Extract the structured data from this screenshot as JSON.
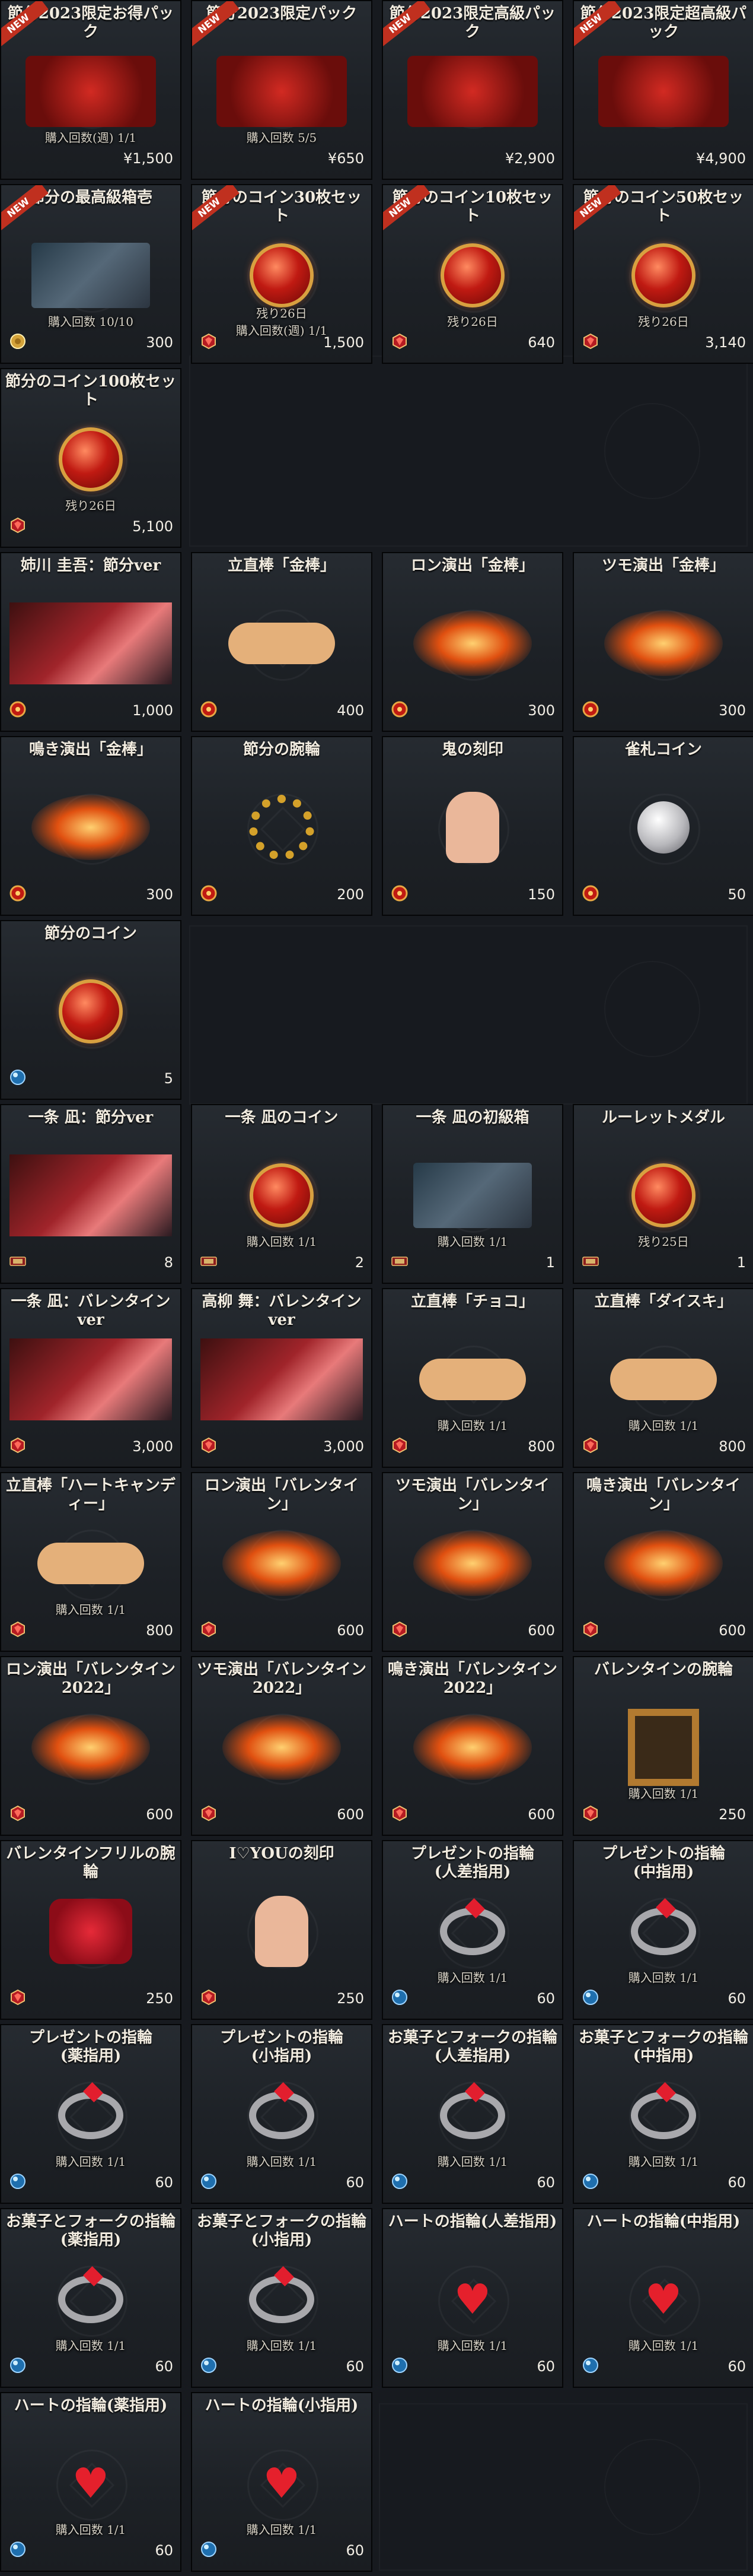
{
  "shop": {
    "sections": [
      {
        "name": "setsubun-2023-packs",
        "items": [
          {
            "title": "節分2023限定お得パック",
            "icon": "pack-icon",
            "badge": "NEW",
            "limit": "購入回数(週) 1/1",
            "currency": "yen",
            "price": "¥1,500"
          },
          {
            "title": "節分2023限定パック",
            "icon": "pack-icon",
            "badge": "NEW",
            "limit": "購入回数 5/5",
            "currency": "yen",
            "price": "¥650"
          },
          {
            "title": "節分2023限定高級パック",
            "icon": "pack-icon",
            "badge": "NEW",
            "limit": "",
            "currency": "yen",
            "price": "¥2,900"
          },
          {
            "title": "節分2023限定超高級パック",
            "icon": "pack-icon",
            "badge": "NEW",
            "limit": "",
            "currency": "yen",
            "price": "¥4,900"
          },
          {
            "title": "節分の最高級箱壱",
            "icon": "chest-icon",
            "badge": "NEW",
            "limit": "購入回数 10/10",
            "currency": "coin-gold",
            "price": "300"
          },
          {
            "title": "節分のコイン30枚セット",
            "icon": "setsubun-coin-icon",
            "badge": "NEW",
            "limit": "残り26日\n購入回数(週) 1/1",
            "currency": "jewel",
            "price": "1,500"
          },
          {
            "title": "節分のコイン10枚セット",
            "icon": "setsubun-coin-icon",
            "badge": "NEW",
            "limit": "残り26日",
            "currency": "jewel",
            "price": "640"
          },
          {
            "title": "節分のコイン50枚セット",
            "icon": "setsubun-coin-icon",
            "badge": "NEW",
            "limit": "残り26日",
            "currency": "jewel",
            "price": "3,140"
          },
          {
            "title": "節分のコイン100枚セット",
            "icon": "setsubun-coin-icon",
            "badge": "",
            "limit": "残り26日",
            "currency": "jewel",
            "price": "5,100"
          }
        ]
      },
      {
        "name": "setsubun-coin-exchange",
        "items": [
          {
            "title": "姉川 圭吾：節分ver",
            "icon": "character-art-icon",
            "limit": "",
            "currency": "setsubun-coin",
            "price": "1,000"
          },
          {
            "title": "立直棒「金棒」",
            "icon": "riichi-stick-icon",
            "limit": "",
            "currency": "setsubun-coin",
            "price": "400"
          },
          {
            "title": "ロン演出「金棒」",
            "icon": "ron-effect-icon",
            "limit": "",
            "currency": "setsubun-coin",
            "price": "300"
          },
          {
            "title": "ツモ演出「金棒」",
            "icon": "tsumo-effect-icon",
            "limit": "",
            "currency": "setsubun-coin",
            "price": "300"
          },
          {
            "title": "鳴き演出「金棒」",
            "icon": "call-effect-icon",
            "limit": "",
            "currency": "setsubun-coin",
            "price": "300"
          },
          {
            "title": "節分の腕輪",
            "icon": "bracelet-icon",
            "limit": "",
            "currency": "setsubun-coin",
            "price": "200"
          },
          {
            "title": "鬼の刻印",
            "icon": "hand-mark-icon",
            "limit": "",
            "currency": "setsubun-coin",
            "price": "150"
          },
          {
            "title": "雀札コイン",
            "icon": "silver-coin-icon",
            "limit": "",
            "currency": "setsubun-coin",
            "price": "50"
          },
          {
            "title": "節分のコイン",
            "icon": "setsubun-coin-icon",
            "limit": "",
            "currency": "orb",
            "price": "5"
          }
        ]
      },
      {
        "name": "ichijo-valentine",
        "items": [
          {
            "title": "一条 凪：節分ver",
            "icon": "character-art-icon",
            "limit": "",
            "currency": "ticket",
            "price": "8"
          },
          {
            "title": "一条 凪のコイン",
            "icon": "nagi-coin-icon",
            "limit": "購入回数 1/1",
            "currency": "ticket",
            "price": "2"
          },
          {
            "title": "一条 凪の初級箱",
            "icon": "chest-icon",
            "limit": "購入回数 1/1",
            "currency": "ticket",
            "price": "1"
          },
          {
            "title": "ルーレットメダル",
            "icon": "roulette-medal-icon",
            "limit": "残り25日",
            "currency": "ticket",
            "price": "1"
          },
          {
            "title": "一条 凪：バレンタインver",
            "icon": "character-art-icon",
            "limit": "",
            "currency": "jewel",
            "price": "3,000"
          },
          {
            "title": "高柳 舞：バレンタインver",
            "icon": "character-art-icon",
            "limit": "",
            "currency": "jewel",
            "price": "3,000"
          },
          {
            "title": "立直棒「チョコ」",
            "icon": "riichi-stick-icon",
            "limit": "購入回数 1/1",
            "currency": "jewel",
            "price": "800"
          },
          {
            "title": "立直棒「ダイスキ」",
            "icon": "riichi-stick-icon",
            "limit": "購入回数 1/1",
            "currency": "jewel",
            "price": "800"
          },
          {
            "title": "立直棒「ハートキャンディー」",
            "icon": "riichi-stick-icon",
            "limit": "購入回数 1/1",
            "currency": "jewel",
            "price": "800"
          },
          {
            "title": "ロン演出「バレンタイン」",
            "icon": "ron-effect-icon",
            "limit": "",
            "currency": "jewel",
            "price": "600"
          },
          {
            "title": "ツモ演出「バレンタイン」",
            "icon": "tsumo-effect-icon",
            "limit": "",
            "currency": "jewel",
            "price": "600"
          },
          {
            "title": "鳴き演出「バレンタイン」",
            "icon": "call-effect-icon",
            "limit": "",
            "currency": "jewel",
            "price": "600"
          },
          {
            "title": "ロン演出「バレンタイン2022」",
            "icon": "ron-effect-icon",
            "limit": "",
            "currency": "jewel",
            "price": "600"
          },
          {
            "title": "ツモ演出「バレンタイン2022」",
            "icon": "tsumo-effect-icon",
            "limit": "",
            "currency": "jewel",
            "price": "600"
          },
          {
            "title": "鳴き演出「バレンタイン2022」",
            "icon": "call-effect-icon",
            "limit": "",
            "currency": "jewel",
            "price": "600"
          },
          {
            "title": "バレンタインの腕輪",
            "icon": "heart-frame-icon",
            "limit": "購入回数 1/1",
            "currency": "jewel",
            "price": "250"
          },
          {
            "title": "バレンタインフリルの腕輪",
            "icon": "ribbon-bracelet-icon",
            "limit": "",
            "currency": "jewel",
            "price": "250"
          },
          {
            "title": "I♡YOUの刻印",
            "icon": "hand-mark-icon",
            "limit": "",
            "currency": "jewel",
            "price": "250"
          },
          {
            "title": "プレゼントの指輪\n(人差指用)",
            "icon": "ring-icon",
            "limit": "購入回数 1/1",
            "currency": "orb",
            "price": "60"
          },
          {
            "title": "プレゼントの指輪\n(中指用)",
            "icon": "ring-icon",
            "limit": "購入回数 1/1",
            "currency": "orb",
            "price": "60"
          },
          {
            "title": "プレゼントの指輪\n(薬指用)",
            "icon": "ring-icon",
            "limit": "購入回数 1/1",
            "currency": "orb",
            "price": "60"
          },
          {
            "title": "プレゼントの指輪\n(小指用)",
            "icon": "ring-icon",
            "limit": "購入回数 1/1",
            "currency": "orb",
            "price": "60"
          },
          {
            "title": "お菓子とフォークの指輪\n(人差指用)",
            "icon": "ring-icon",
            "limit": "購入回数 1/1",
            "currency": "orb",
            "price": "60"
          },
          {
            "title": "お菓子とフォークの指輪\n(中指用)",
            "icon": "ring-icon",
            "limit": "購入回数 1/1",
            "currency": "orb",
            "price": "60"
          },
          {
            "title": "お菓子とフォークの指輪\n(薬指用)",
            "icon": "ring-icon",
            "limit": "購入回数 1/1",
            "currency": "orb",
            "price": "60"
          },
          {
            "title": "お菓子とフォークの指輪\n(小指用)",
            "icon": "ring-icon",
            "limit": "購入回数 1/1",
            "currency": "orb",
            "price": "60"
          },
          {
            "title": "ハートの指輪(人差指用)",
            "icon": "heart-ring-icon",
            "limit": "購入回数 1/1",
            "currency": "orb",
            "price": "60"
          },
          {
            "title": "ハートの指輪(中指用)",
            "icon": "heart-ring-icon",
            "limit": "購入回数 1/1",
            "currency": "orb",
            "price": "60"
          },
          {
            "title": "ハートの指輪(薬指用)",
            "icon": "heart-ring-icon",
            "limit": "購入回数 1/1",
            "currency": "orb",
            "price": "60"
          },
          {
            "title": "ハートの指輪(小指用)",
            "icon": "heart-ring-icon",
            "limit": "購入回数 1/1",
            "currency": "orb",
            "price": "60"
          }
        ]
      }
    ]
  },
  "colors": {
    "background": "#171a1f",
    "card": "#22262b",
    "card_border": "#050607",
    "title_text": "#f2ece0",
    "price_text": "#f3efe6",
    "setsubun_red": "#c01a12",
    "badge_red": "#c0301f"
  },
  "currency_icons": {
    "yen": "",
    "jewel": "red-jewel-icon",
    "setsubun-coin": "setsubun-coin-icon",
    "orb": "blue-orb-icon",
    "ticket": "ticket-icon",
    "coin-gold": "gold-coin-icon"
  }
}
